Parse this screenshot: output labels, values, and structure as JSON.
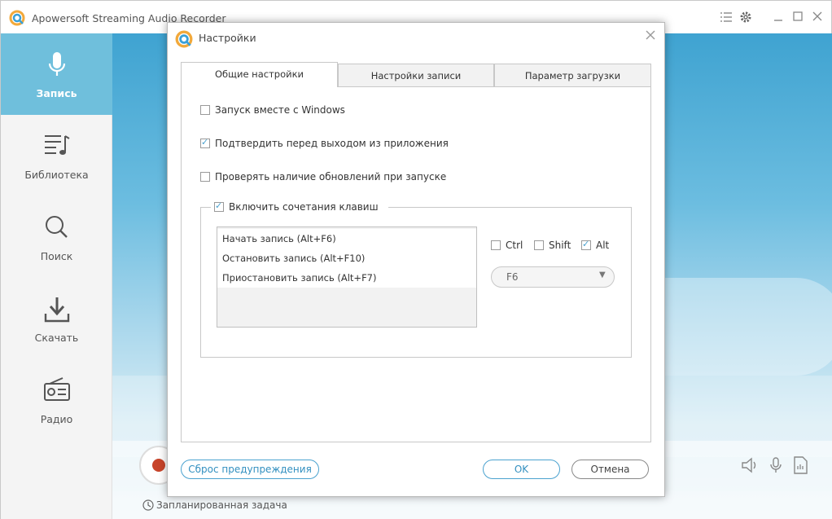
{
  "app": {
    "title": "Apowersoft Streaming Audio Recorder",
    "icons": [
      "logo-icon",
      "list-icon",
      "gear-icon",
      "minimize-icon",
      "maximize-icon",
      "close-icon"
    ]
  },
  "sidebar": {
    "items": [
      {
        "label": "Запись",
        "icon": "microphone-icon",
        "active": true
      },
      {
        "label": "Библиотека",
        "icon": "music-list-icon",
        "active": false
      },
      {
        "label": "Поиск",
        "icon": "search-icon",
        "active": false
      },
      {
        "label": "Скачать",
        "icon": "download-icon",
        "active": false
      },
      {
        "label": "Радио",
        "icon": "radio-icon",
        "active": false
      }
    ]
  },
  "statusbar": {
    "scheduled_task": "Запланированная задача"
  },
  "dialog": {
    "title": "Настройки",
    "tabs": [
      {
        "label": "Общие настройки",
        "active": true
      },
      {
        "label": "Настройки записи",
        "active": false
      },
      {
        "label": "Параметр загрузки",
        "active": false
      }
    ],
    "options": [
      {
        "label": "Запуск вместе с Windows",
        "checked": false
      },
      {
        "label": "Подтвердить перед выходом из приложения",
        "checked": true
      },
      {
        "label": "Проверять наличие обновлений при запуске",
        "checked": false
      }
    ],
    "hotkeys": {
      "enable_label": "Включить сочетания клавиш",
      "enabled": true,
      "items": [
        "Начать запись (Alt+F6)",
        "Остановить запись (Alt+F10)",
        "Приостановить запись (Alt+F7)"
      ],
      "modifiers": [
        {
          "label": "Ctrl",
          "checked": false
        },
        {
          "label": "Shift",
          "checked": false
        },
        {
          "label": "Alt",
          "checked": true
        }
      ],
      "key": "F6"
    },
    "buttons": {
      "reset": "Сброс предупреждения",
      "ok": "OK",
      "cancel": "Отмена"
    }
  },
  "colors": {
    "accent": "#4aa2cf",
    "sidebar_active": "#6fbfdc",
    "record_dot": "#c8442a"
  }
}
